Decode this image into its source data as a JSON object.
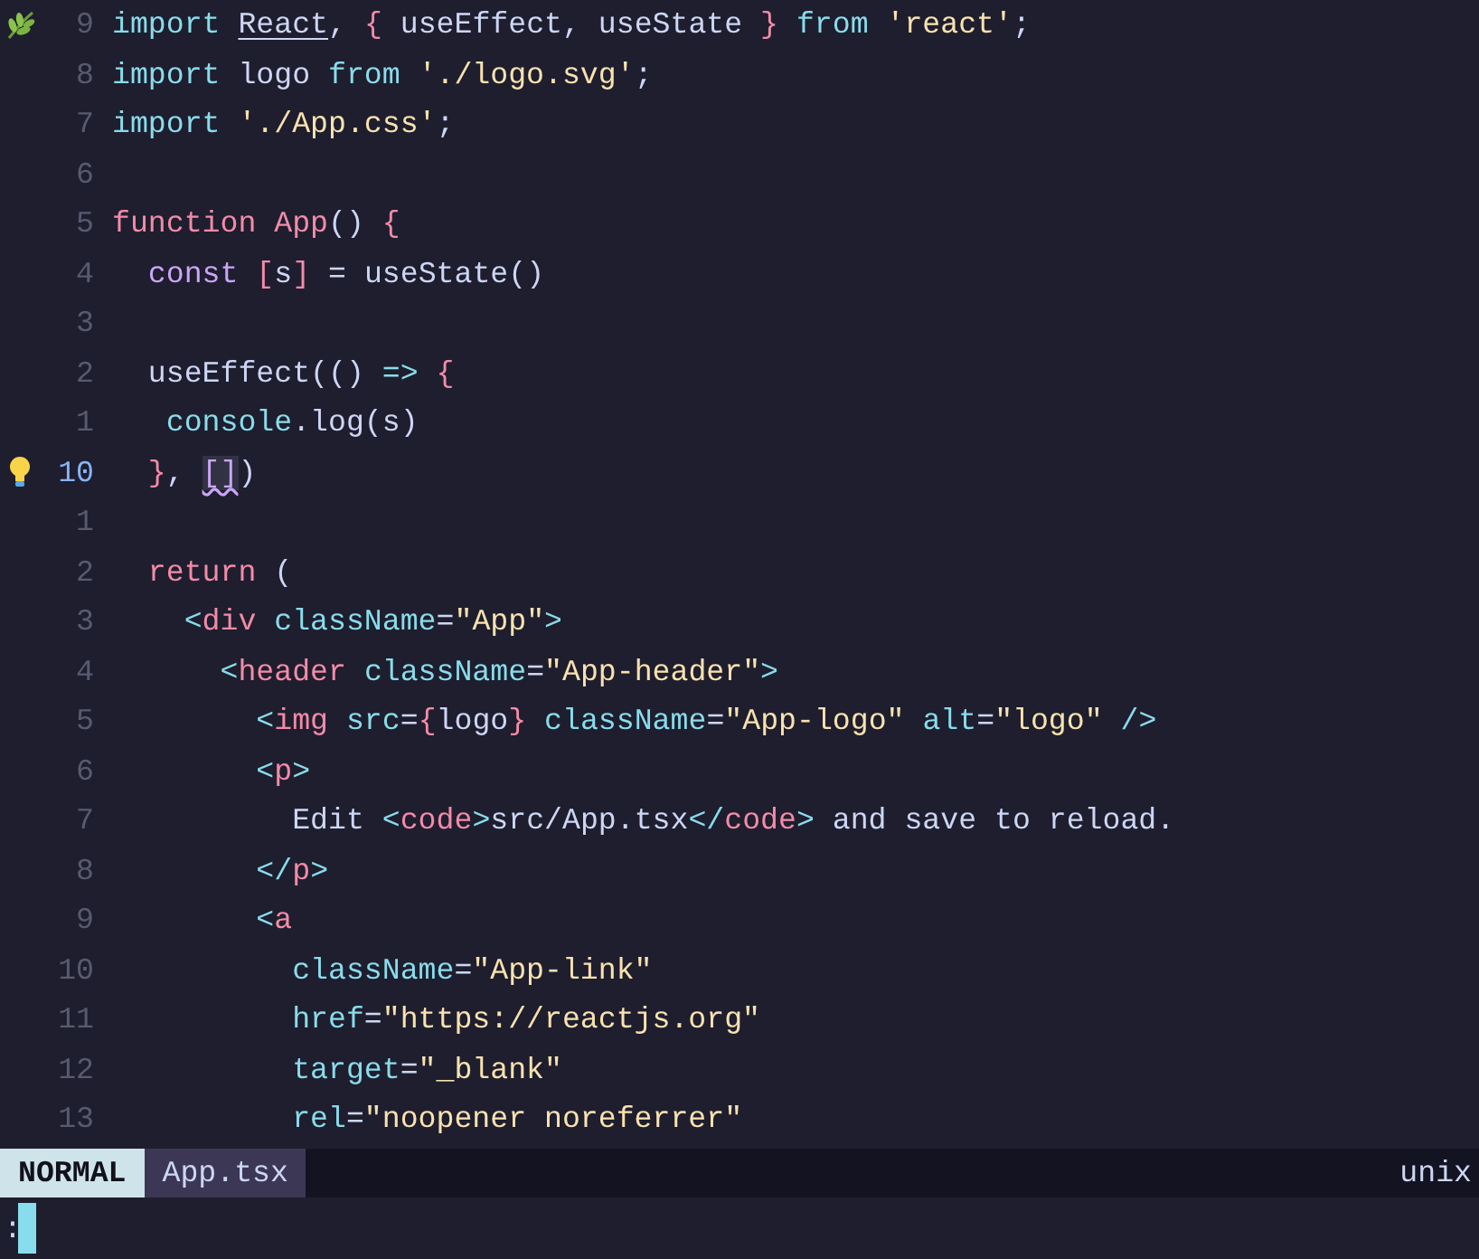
{
  "lines": [
    {
      "number": "9",
      "leaf_sign": true,
      "tokens": [
        {
          "text": "import ",
          "kind": "kw"
        },
        {
          "text": "React",
          "kind": "plain",
          "underline": true
        },
        {
          "text": ", ",
          "kind": "plain"
        },
        {
          "text": "{",
          "kind": "brace"
        },
        {
          "text": " useEffect, useState ",
          "kind": "plain"
        },
        {
          "text": "}",
          "kind": "brace"
        },
        {
          "text": " from ",
          "kind": "kw"
        },
        {
          "text": "'react'",
          "kind": "str"
        },
        {
          "text": ";",
          "kind": "plain"
        }
      ]
    },
    {
      "number": "8",
      "tokens": [
        {
          "text": "import ",
          "kind": "kw"
        },
        {
          "text": "logo ",
          "kind": "plain"
        },
        {
          "text": "from ",
          "kind": "kw"
        },
        {
          "text": "'./logo.svg'",
          "kind": "str"
        },
        {
          "text": ";",
          "kind": "plain"
        }
      ]
    },
    {
      "number": "7",
      "tokens": [
        {
          "text": "import ",
          "kind": "kw"
        },
        {
          "text": "'./App.css'",
          "kind": "str"
        },
        {
          "text": ";",
          "kind": "plain"
        }
      ]
    },
    {
      "number": "6"
    },
    {
      "number": "5",
      "tokens": [
        {
          "text": "function ",
          "kind": "brace"
        },
        {
          "text": "App",
          "kind": "brace"
        },
        {
          "text": "() ",
          "kind": "plain"
        },
        {
          "text": "{",
          "kind": "brace"
        }
      ]
    },
    {
      "number": "4",
      "tokens": [
        {
          "text": "  const ",
          "kind": "purple"
        },
        {
          "text": "[",
          "kind": "brace"
        },
        {
          "text": "s",
          "kind": "plain"
        },
        {
          "text": "]",
          "kind": "brace"
        },
        {
          "text": " = useState()",
          "kind": "plain"
        }
      ]
    },
    {
      "number": "3"
    },
    {
      "number": "2",
      "tokens": [
        {
          "text": "  useEffect(() ",
          "kind": "plain"
        },
        {
          "text": "=> ",
          "kind": "op"
        },
        {
          "text": "{",
          "kind": "brace"
        }
      ]
    },
    {
      "number": "1",
      "tokens": [
        {
          "text": "   console",
          "kind": "op"
        },
        {
          "text": ".log(s)",
          "kind": "plain"
        }
      ]
    },
    {
      "number": "10",
      "current": true,
      "lightbulb": true,
      "tokens": [
        {
          "text": "  }",
          "kind": "brace"
        },
        {
          "text": ", ",
          "kind": "plain"
        },
        {
          "text": "[]",
          "kind": "purple",
          "squiggle": true
        },
        {
          "text": ")",
          "kind": "plain"
        }
      ]
    },
    {
      "number": "1"
    },
    {
      "number": "2",
      "tokens": [
        {
          "text": "  return ",
          "kind": "brace"
        },
        {
          "text": "(",
          "kind": "plain"
        }
      ]
    },
    {
      "number": "3",
      "tokens": [
        {
          "text": "    <",
          "kind": "op"
        },
        {
          "text": "div ",
          "kind": "brace"
        },
        {
          "text": "className",
          "kind": "op"
        },
        {
          "text": "=",
          "kind": "plain"
        },
        {
          "text": "\"App\"",
          "kind": "str"
        },
        {
          "text": ">",
          "kind": "op"
        }
      ]
    },
    {
      "number": "4",
      "tokens": [
        {
          "text": "      <",
          "kind": "op"
        },
        {
          "text": "header ",
          "kind": "brace"
        },
        {
          "text": "className",
          "kind": "op"
        },
        {
          "text": "=",
          "kind": "plain"
        },
        {
          "text": "\"App-header\"",
          "kind": "str"
        },
        {
          "text": ">",
          "kind": "op"
        }
      ]
    },
    {
      "number": "5",
      "tokens": [
        {
          "text": "        <",
          "kind": "op"
        },
        {
          "text": "img ",
          "kind": "brace"
        },
        {
          "text": "src",
          "kind": "op"
        },
        {
          "text": "=",
          "kind": "plain"
        },
        {
          "text": "{",
          "kind": "brace"
        },
        {
          "text": "logo",
          "kind": "plain"
        },
        {
          "text": "}",
          "kind": "brace"
        },
        {
          "text": " className",
          "kind": "op"
        },
        {
          "text": "=",
          "kind": "plain"
        },
        {
          "text": "\"App-logo\"",
          "kind": "str"
        },
        {
          "text": " alt",
          "kind": "op"
        },
        {
          "text": "=",
          "kind": "plain"
        },
        {
          "text": "\"logo\"",
          "kind": "str"
        },
        {
          "text": " />",
          "kind": "op"
        }
      ]
    },
    {
      "number": "6",
      "tokens": [
        {
          "text": "        <",
          "kind": "op"
        },
        {
          "text": "p",
          "kind": "brace"
        },
        {
          "text": ">",
          "kind": "op"
        }
      ]
    },
    {
      "number": "7",
      "tokens": [
        {
          "text": "          Edit ",
          "kind": "plain"
        },
        {
          "text": "<",
          "kind": "op"
        },
        {
          "text": "code",
          "kind": "brace"
        },
        {
          "text": ">",
          "kind": "op"
        },
        {
          "text": "src/App.tsx",
          "kind": "plain"
        },
        {
          "text": "</",
          "kind": "op"
        },
        {
          "text": "code",
          "kind": "brace"
        },
        {
          "text": ">",
          "kind": "op"
        },
        {
          "text": " and save to reload.",
          "kind": "plain"
        }
      ]
    },
    {
      "number": "8",
      "tokens": [
        {
          "text": "        </",
          "kind": "op"
        },
        {
          "text": "p",
          "kind": "brace"
        },
        {
          "text": ">",
          "kind": "op"
        }
      ]
    },
    {
      "number": "9",
      "tokens": [
        {
          "text": "        <",
          "kind": "op"
        },
        {
          "text": "a",
          "kind": "brace"
        }
      ]
    },
    {
      "number": "10",
      "tokens": [
        {
          "text": "          className",
          "kind": "op"
        },
        {
          "text": "=",
          "kind": "plain"
        },
        {
          "text": "\"App-link\"",
          "kind": "str"
        }
      ]
    },
    {
      "number": "11",
      "tokens": [
        {
          "text": "          href",
          "kind": "op"
        },
        {
          "text": "=",
          "kind": "plain"
        },
        {
          "text": "\"https://reactjs.org\"",
          "kind": "str"
        }
      ]
    },
    {
      "number": "12",
      "tokens": [
        {
          "text": "          target",
          "kind": "op"
        },
        {
          "text": "=",
          "kind": "plain"
        },
        {
          "text": "\"_blank\"",
          "kind": "str"
        }
      ]
    },
    {
      "number": "13",
      "tokens": [
        {
          "text": "          rel",
          "kind": "op"
        },
        {
          "text": "=",
          "kind": "plain"
        },
        {
          "text": "\"noopener noreferrer\"",
          "kind": "str"
        }
      ]
    }
  ],
  "status_bar": {
    "mode": "NORMAL",
    "file": "App.tsx",
    "format": "unix"
  },
  "command_line": {
    "prompt": ":"
  }
}
